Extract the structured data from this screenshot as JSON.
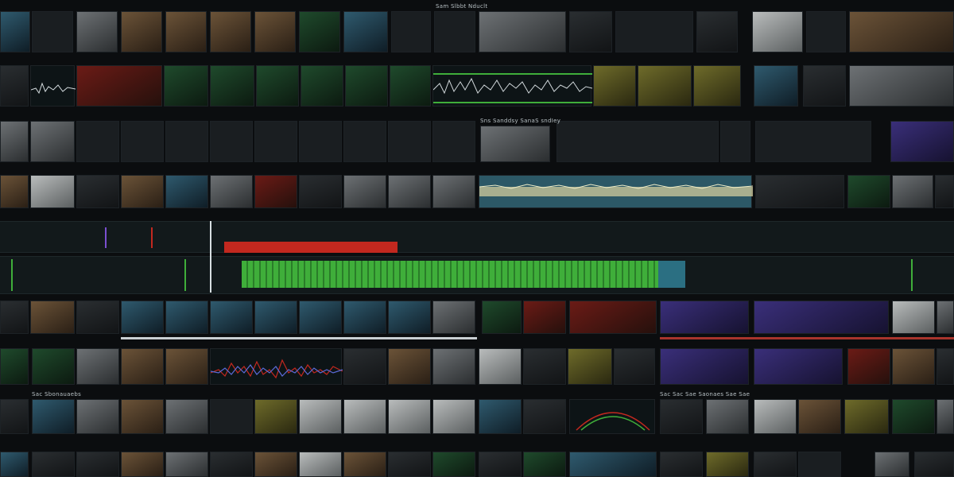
{
  "captions": {
    "row1_top": "Sam  Slbbt  Nduclt",
    "row3_panel": "Sns  Sanddsy  SanaS  sndIey",
    "row9_left": "Sac  Sbonauaebs",
    "row9_right": "Sac  Sac  Sae  Saonaes  Sae  Sae"
  },
  "colors": {
    "accent_green": "#3fae3a",
    "accent_red": "#c2281f",
    "accent_teal": "#2b6f82",
    "background": "#0b0d0f"
  }
}
